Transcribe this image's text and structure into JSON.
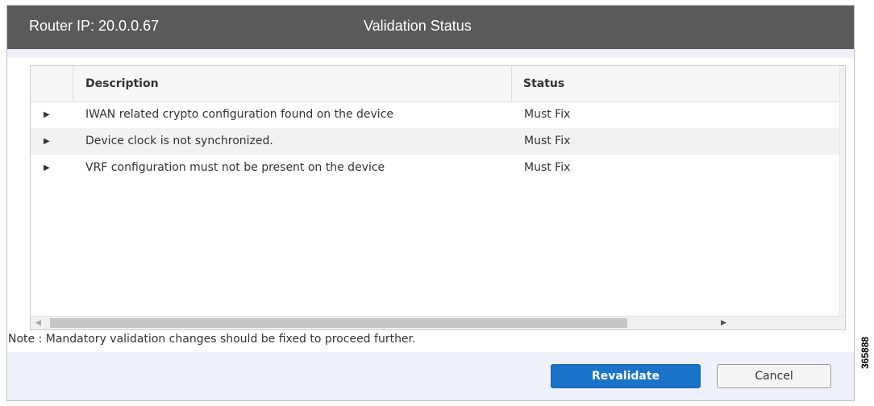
{
  "titlebar": {
    "router_ip": "Router IP: 20.0.0.67",
    "title": "Validation Status"
  },
  "table": {
    "columns": [
      "Description",
      "Status"
    ],
    "rows": [
      {
        "description": "IWAN related crypto configuration found on the device",
        "status": "Must Fix"
      },
      {
        "description": "Device clock is not synchronized.",
        "status": "Must Fix"
      },
      {
        "description": "VRF configuration must not be present on the device",
        "status": "Must Fix"
      }
    ]
  },
  "note": "Note : Mandatory validation changes should be fixed to proceed further.",
  "buttons": {
    "revalidate": "Revalidate",
    "cancel": "Cancel"
  },
  "figure_id": "365888",
  "colors": {
    "titlebar_bg": "#5a5a5a",
    "primary_button": "#1a73c9",
    "dialog_bg": "#eef1f9"
  },
  "icons": {
    "row_expand": "triangle-right-icon",
    "scroll_left": "scroll-left-icon",
    "scroll_right": "scroll-right-icon"
  }
}
